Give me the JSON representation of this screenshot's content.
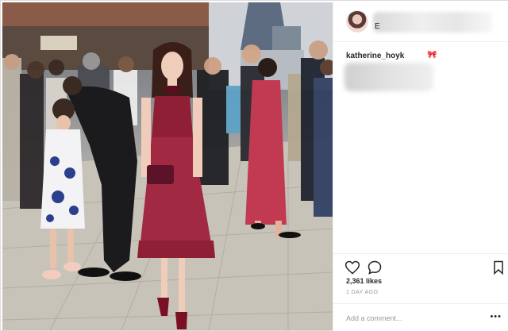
{
  "post": {
    "header_initial": "E",
    "username": "katherine_hoyk",
    "caption_emoji": "🎀",
    "likes": "2,361 likes",
    "time_ago": "1 DAY AGO"
  },
  "comment": {
    "placeholder": "Add a comment...",
    "more_label": "•••"
  },
  "icons": {
    "like": "heart-icon",
    "comment": "speech-bubble-icon",
    "save": "bookmark-icon"
  },
  "colors": {
    "dress": "#8e1f34",
    "pink_dress": "#c23a52",
    "text": "#262626",
    "muted": "#999999",
    "divider": "#efefef"
  }
}
